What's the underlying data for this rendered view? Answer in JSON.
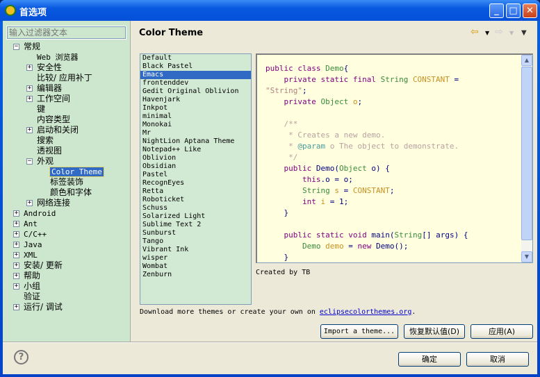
{
  "window": {
    "title": "首选项",
    "minimize": "_",
    "maximize": "□",
    "close": "✕"
  },
  "filter": {
    "placeholder": "输入过滤器文本"
  },
  "tree": [
    {
      "label": "常规",
      "level": 0,
      "exp": "-"
    },
    {
      "label": "Web 浏览器",
      "level": 1,
      "exp": ""
    },
    {
      "label": "安全性",
      "level": 1,
      "exp": "+"
    },
    {
      "label": "比较/ 应用补丁",
      "level": 1,
      "exp": ""
    },
    {
      "label": "编辑器",
      "level": 1,
      "exp": "+"
    },
    {
      "label": "工作空间",
      "level": 1,
      "exp": "+"
    },
    {
      "label": "键",
      "level": 1,
      "exp": ""
    },
    {
      "label": "内容类型",
      "level": 1,
      "exp": ""
    },
    {
      "label": "启动和关闭",
      "level": 1,
      "exp": "+"
    },
    {
      "label": "搜索",
      "level": 1,
      "exp": ""
    },
    {
      "label": "透视图",
      "level": 1,
      "exp": ""
    },
    {
      "label": "外观",
      "level": 1,
      "exp": "-"
    },
    {
      "label": "Color Theme",
      "level": 2,
      "exp": "",
      "selected": true
    },
    {
      "label": "标签装饰",
      "level": 2,
      "exp": ""
    },
    {
      "label": "颜色和字体",
      "level": 2,
      "exp": ""
    },
    {
      "label": "网络连接",
      "level": 1,
      "exp": "+"
    },
    {
      "label": "Android",
      "level": 0,
      "exp": "+"
    },
    {
      "label": "Ant",
      "level": 0,
      "exp": "+"
    },
    {
      "label": "C/C++",
      "level": 0,
      "exp": "+"
    },
    {
      "label": "Java",
      "level": 0,
      "exp": "+"
    },
    {
      "label": "XML",
      "level": 0,
      "exp": "+"
    },
    {
      "label": "安装/ 更新",
      "level": 0,
      "exp": "+"
    },
    {
      "label": "帮助",
      "level": 0,
      "exp": "+"
    },
    {
      "label": "小组",
      "level": 0,
      "exp": "+"
    },
    {
      "label": "验证",
      "level": 0,
      "exp": ""
    },
    {
      "label": "运行/ 调试",
      "level": 0,
      "exp": "+"
    }
  ],
  "page": {
    "title": "Color Theme",
    "back_icon": "back-arrow-icon",
    "forward_icon": "forward-arrow-icon",
    "menu_icon": "view-menu-icon"
  },
  "themes": {
    "selected": "Emacs",
    "items": [
      "Default",
      "Black Pastel",
      "Emacs",
      "frontenddev",
      "Gedit Original Oblivion",
      "Havenjark",
      "Inkpot",
      "minimal",
      "Monokai",
      "Mr",
      "NightLion Aptana Theme",
      "Notepad++ Like",
      "Oblivion",
      "Obsidian",
      "Pastel",
      "RecognEyes",
      "Retta",
      "Roboticket",
      "Schuss",
      "Solarized Light",
      "Sublime Text 2",
      "Sunburst",
      "Tango",
      "Vibrant Ink",
      "wisper",
      "Wombat",
      "Zenburn"
    ]
  },
  "preview": {
    "background": "#ffffe0",
    "lines": [
      [
        [
          "k",
          "public class "
        ],
        [
          "t",
          "Demo"
        ],
        [
          "",
          "{"
        ]
      ],
      [
        [
          "",
          "    "
        ],
        [
          "k",
          "private static final "
        ],
        [
          "t",
          "String "
        ],
        [
          "c",
          "CONSTANT"
        ],
        [
          "",
          " ="
        ]
      ],
      [
        [
          "s",
          "\"String\""
        ],
        [
          "",
          ";"
        ]
      ],
      [
        [
          "",
          "    "
        ],
        [
          "k",
          "private "
        ],
        [
          "t",
          "Object "
        ],
        [
          "c",
          "o"
        ],
        [
          "",
          ";"
        ]
      ],
      [
        [
          "",
          ""
        ]
      ],
      [
        [
          "m",
          "    /**"
        ]
      ],
      [
        [
          "m",
          "     * Creates a new demo."
        ]
      ],
      [
        [
          "m",
          "     * "
        ],
        [
          "d",
          "@param"
        ],
        [
          "m",
          " o The object to demonstrate."
        ]
      ],
      [
        [
          "m",
          "     */"
        ]
      ],
      [
        [
          "",
          "    "
        ],
        [
          "k",
          "public "
        ],
        [
          "",
          "Demo("
        ],
        [
          "t",
          "Object "
        ],
        [
          "",
          "o) {"
        ]
      ],
      [
        [
          "",
          "        "
        ],
        [
          "k",
          "this"
        ],
        [
          "",
          ".o = o;"
        ]
      ],
      [
        [
          "",
          "        "
        ],
        [
          "t",
          "String "
        ],
        [
          "c",
          "s"
        ],
        [
          "",
          " = "
        ],
        [
          "c",
          "CONSTANT"
        ],
        [
          "",
          ";"
        ]
      ],
      [
        [
          "",
          "        "
        ],
        [
          "k",
          "int "
        ],
        [
          "c",
          "i"
        ],
        [
          "",
          " = 1;"
        ]
      ],
      [
        [
          "",
          "    }"
        ]
      ],
      [
        [
          "",
          ""
        ]
      ],
      [
        [
          "",
          "    "
        ],
        [
          "k",
          "public static void "
        ],
        [
          "",
          "main("
        ],
        [
          "t",
          "String"
        ],
        [
          "",
          "[] args) {"
        ]
      ],
      [
        [
          "",
          "        "
        ],
        [
          "t",
          "Demo "
        ],
        [
          "c",
          "demo"
        ],
        [
          "",
          " = "
        ],
        [
          "k",
          "new "
        ],
        [
          "",
          "Demo();"
        ]
      ],
      [
        [
          "",
          "    }"
        ]
      ]
    ]
  },
  "created_by": "Created by TB",
  "download": {
    "text": "Download more themes or create your own on ",
    "link": "eclipsecolorthemes.org",
    "suffix": "."
  },
  "buttons": {
    "import": "Import a theme...",
    "restore": "恢复默认值(D)",
    "apply": "应用(A)",
    "ok": "确定",
    "cancel": "取消"
  }
}
